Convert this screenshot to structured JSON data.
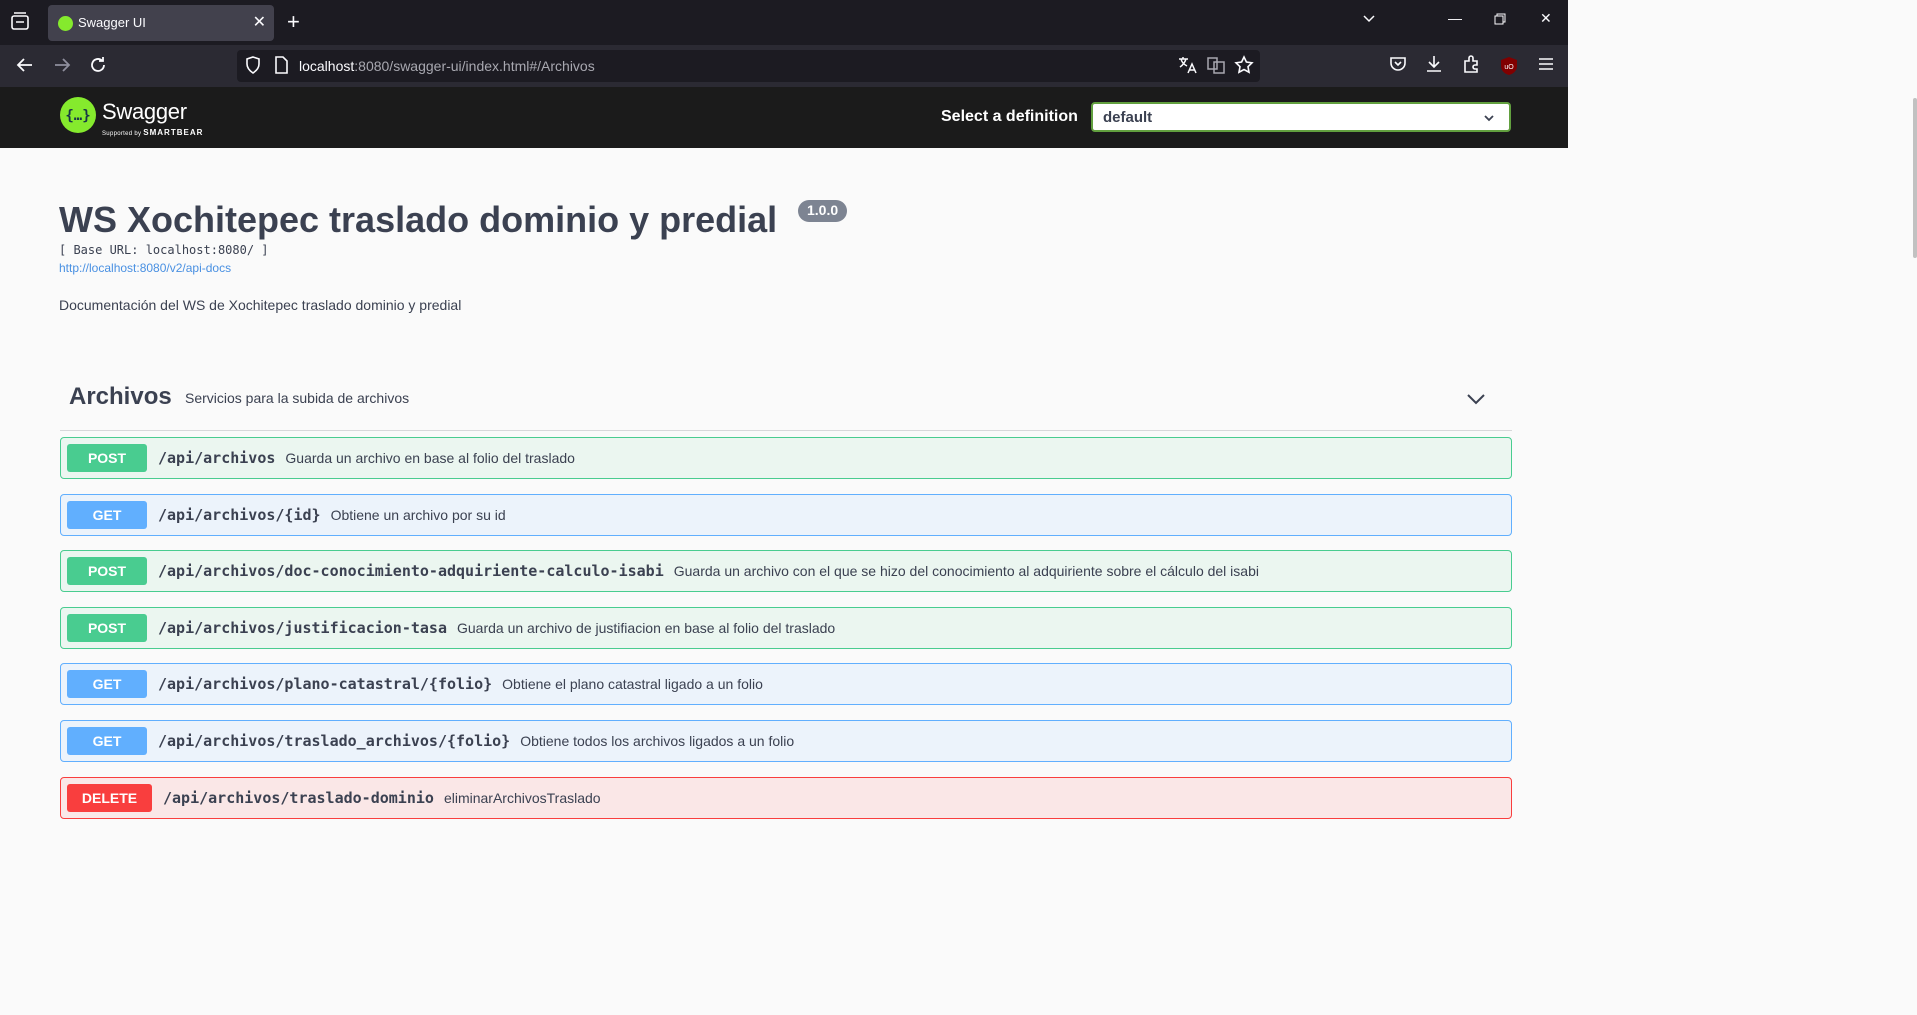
{
  "browser": {
    "tab_title": "Swagger UI",
    "url_host": "localhost",
    "url_rest": ":8080/swagger-ui/index.html#/Archivos"
  },
  "topbar": {
    "logo_text": "Swagger",
    "logo_sub_prefix": "Supported by ",
    "logo_sub_brand": "SMARTBEAR",
    "definition_label": "Select a definition",
    "definition_value": "default"
  },
  "info": {
    "title": "WS Xochitepec traslado dominio y predial",
    "version": "1.0.0",
    "base_url": "[ Base URL: localhost:8080/ ]",
    "docs_link": "http://localhost:8080/v2/api-docs",
    "description": "Documentación del WS de Xochitepec traslado dominio y predial"
  },
  "tag": {
    "name": "Archivos",
    "description": "Servicios para la subida de archivos"
  },
  "operations": [
    {
      "method": "POST",
      "path": "/api/archivos",
      "summary": "Guarda un archivo en base al folio del traslado"
    },
    {
      "method": "GET",
      "path": "/api/archivos/{id}",
      "summary": "Obtiene un archivo por su id"
    },
    {
      "method": "POST",
      "path": "/api/archivos/doc-conocimiento-adquiriente-calculo-isabi",
      "summary": "Guarda un archivo con el que se hizo del conocimiento al adquiriente sobre el cálculo del isabi"
    },
    {
      "method": "POST",
      "path": "/api/archivos/justificacion-tasa",
      "summary": "Guarda un archivo de justifiacion en base al folio del traslado"
    },
    {
      "method": "GET",
      "path": "/api/archivos/plano-catastral/{folio}",
      "summary": "Obtiene el plano catastral ligado a un folio"
    },
    {
      "method": "GET",
      "path": "/api/archivos/traslado_archivos/{folio}",
      "summary": "Obtiene todos los archivos ligados a un folio"
    },
    {
      "method": "DELETE",
      "path": "/api/archivos/traslado-dominio",
      "summary": "eliminarArchivosTraslado"
    }
  ]
}
